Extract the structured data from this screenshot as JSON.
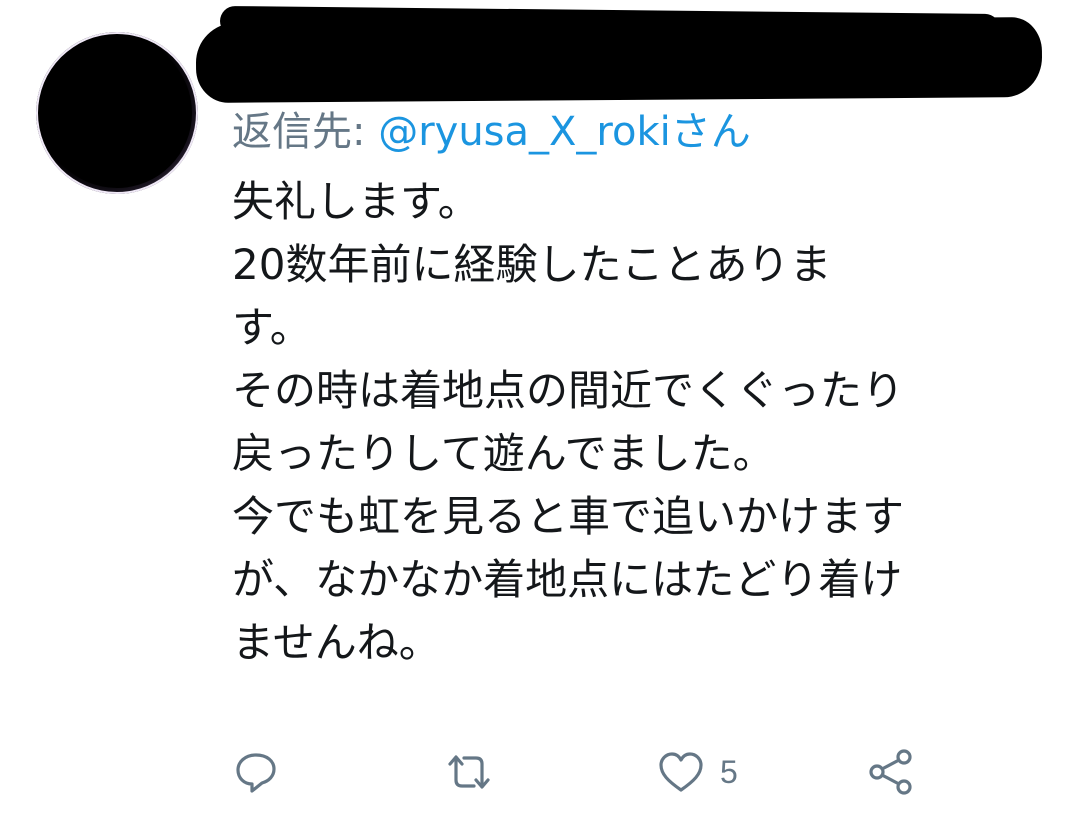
{
  "reply": {
    "prefix": "返信先: ",
    "handle": "@ryusa_X_roki",
    "suffix": "さん"
  },
  "tweet": {
    "lines": [
      "失礼します。",
      "20数年前に経験したことありま",
      "す。",
      "その時は着地点の間近でくぐったり",
      "戻ったりして遊んでました。",
      "今でも虹を見ると車で追いかけます",
      "が、なかなか着地点にはたどり着け",
      "ませんね。"
    ]
  },
  "actions": {
    "reply_icon": "reply-icon",
    "retweet_icon": "retweet-icon",
    "like_icon": "heart-icon",
    "like_count": "5",
    "share_icon": "share-icon"
  },
  "colors": {
    "text": "#14171a",
    "secondary": "#657786",
    "link": "#1b95e0"
  }
}
